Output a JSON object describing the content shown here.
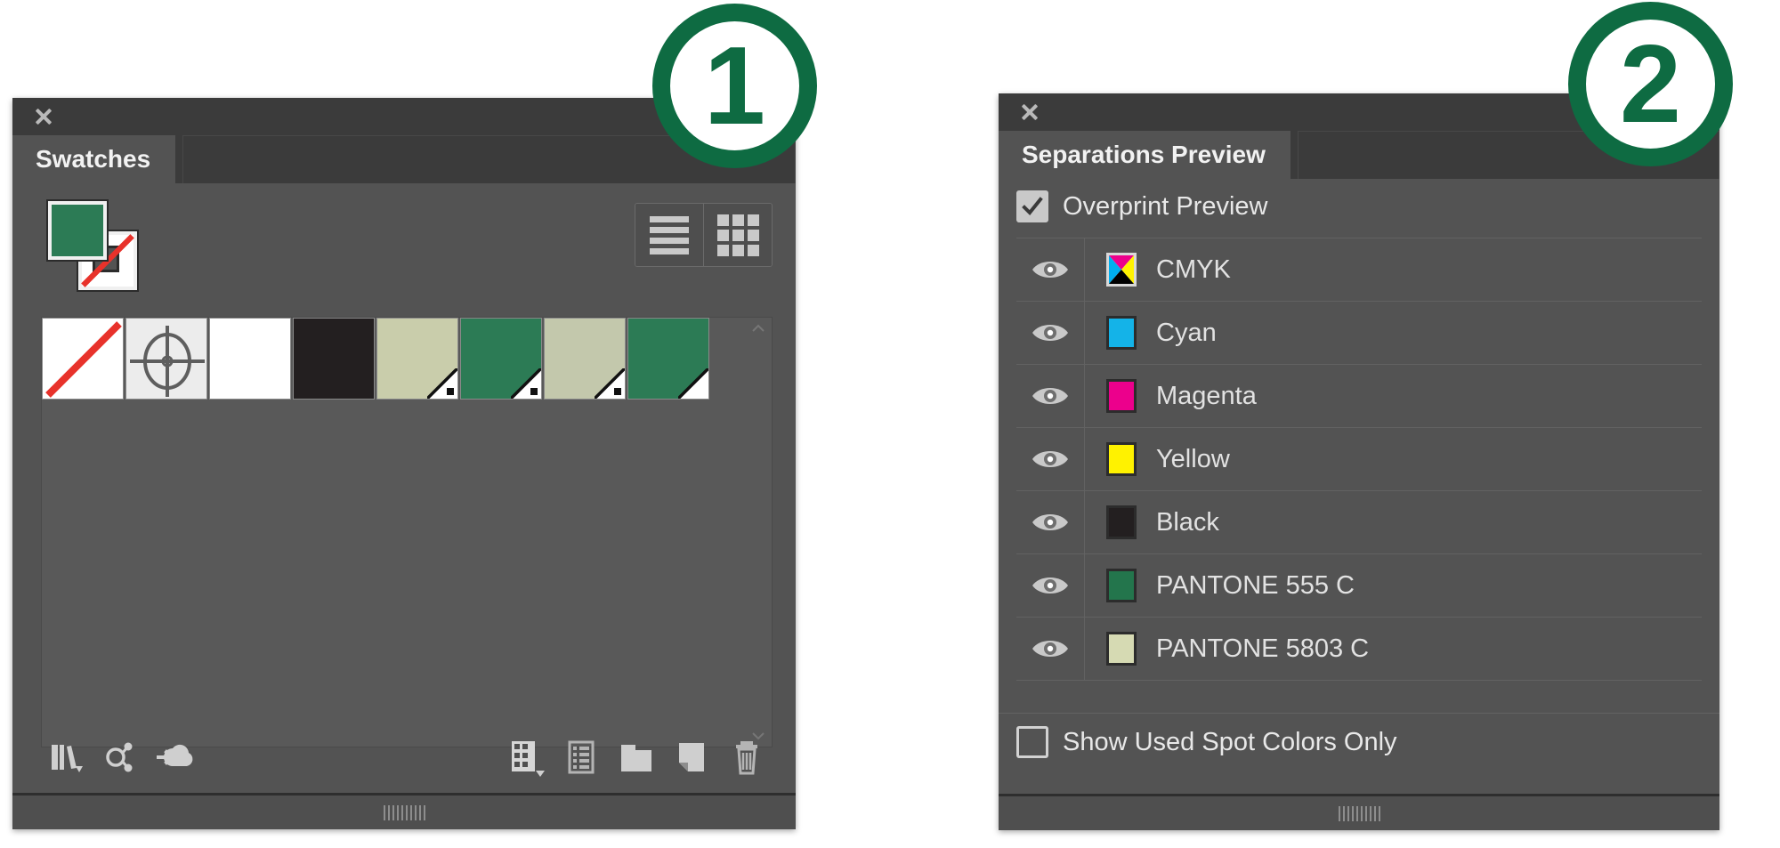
{
  "theme": {
    "panel_bg": "#535353",
    "panel_header_bg": "#3b3b3b",
    "text": "#e8e8e8",
    "accent_green": "#0e6b42",
    "spot_green": "#2c7b55",
    "spot_sage": "#c9cdab"
  },
  "badges": [
    {
      "number": "1",
      "color": "#0e6b42"
    },
    {
      "number": "2",
      "color": "#0e6b42"
    }
  ],
  "swatches_panel": {
    "close_label": "×",
    "tab_label": "Swatches",
    "fill_color": "#2c7b55",
    "stroke_color": "none",
    "view_toggle": {
      "list_view_label": "List View",
      "grid_view_label": "Grid View",
      "active": "grid"
    },
    "swatches": [
      {
        "name": "None",
        "color": "#ffffff",
        "type": "none",
        "spot": false
      },
      {
        "name": "Registration",
        "color": "#ececec",
        "type": "registration",
        "spot": false
      },
      {
        "name": "Paper",
        "color": "#ffffff",
        "type": "process",
        "spot": false
      },
      {
        "name": "Black",
        "color": "#231f20",
        "type": "process",
        "spot": false
      },
      {
        "name": "PANTONE 5803 C",
        "color": "#c9cdab",
        "type": "spot",
        "spot": true
      },
      {
        "name": "PANTONE 555 C",
        "color": "#2c7b55",
        "type": "spot",
        "spot": true
      },
      {
        "name": "PANTONE 5803 C",
        "color": "#c3c8ac",
        "type": "spot",
        "spot": true
      },
      {
        "name": "PANTONE 555 C",
        "color": "#2c7b55",
        "type": "spot",
        "spot": true
      }
    ],
    "toolbar": [
      {
        "icon": "swatch-libraries-icon",
        "label": "Swatch Libraries menu",
        "has_dropdown": true
      },
      {
        "icon": "color-group-link-icon",
        "label": "Show Swatch Kinds menu",
        "has_dropdown": false
      },
      {
        "icon": "add-to-cc-library-icon",
        "label": "Add selected to My Library",
        "has_dropdown": false
      },
      {
        "icon": "swatch-kinds-icon",
        "label": "Show Swatch Kinds menu",
        "has_dropdown": true
      },
      {
        "icon": "swatch-options-icon",
        "label": "Swatch Options",
        "has_dropdown": false
      },
      {
        "icon": "new-color-group-icon",
        "label": "New Color Group",
        "has_dropdown": false
      },
      {
        "icon": "new-swatch-icon",
        "label": "New Swatch",
        "has_dropdown": false
      },
      {
        "icon": "delete-swatch-icon",
        "label": "Delete Swatch",
        "has_dropdown": false
      }
    ]
  },
  "separations_panel": {
    "close_label": "×",
    "tab_label": "Separations Preview",
    "overprint": {
      "label": "Overprint Preview",
      "checked": true
    },
    "rows": [
      {
        "name": "CMYK",
        "color": "cmyk",
        "visible": true
      },
      {
        "name": "Cyan",
        "color": "#14b3e8",
        "visible": true
      },
      {
        "name": "Magenta",
        "color": "#ec008c",
        "visible": true
      },
      {
        "name": "Yellow",
        "color": "#fff200",
        "visible": true
      },
      {
        "name": "Black",
        "color": "#231f20",
        "visible": true
      },
      {
        "name": "PANTONE 555 C",
        "color": "#23754c",
        "visible": true
      },
      {
        "name": "PANTONE 5803 C",
        "color": "#d6dab3",
        "visible": true
      }
    ],
    "show_used_spot": {
      "label": "Show Used Spot Colors Only",
      "checked": false
    }
  }
}
